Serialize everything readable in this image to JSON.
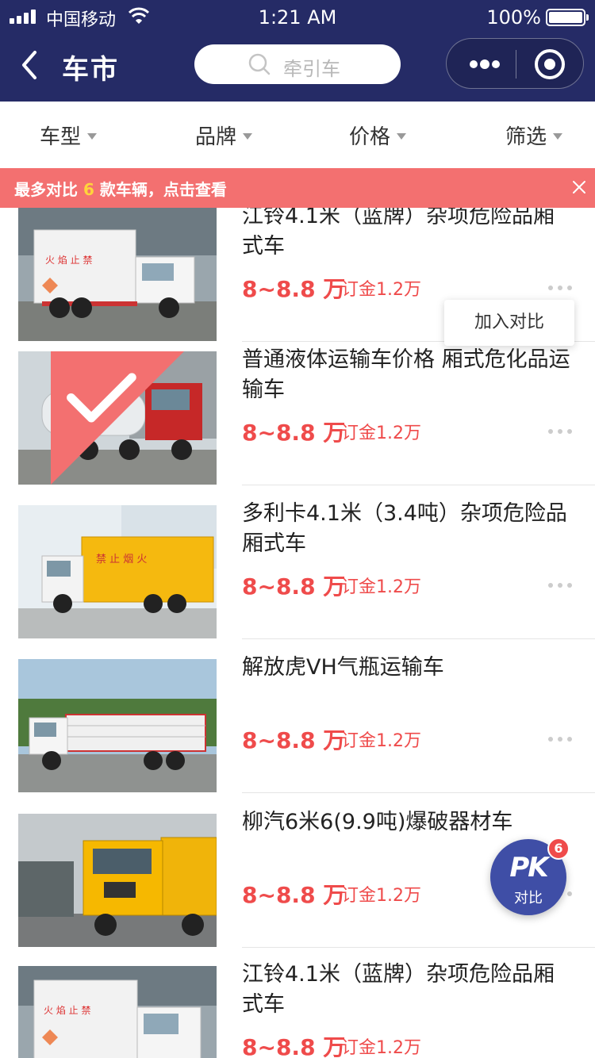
{
  "status_bar": {
    "carrier": "中国移动",
    "time": "1:21 AM",
    "battery": "100%"
  },
  "nav": {
    "title": "车市",
    "search_placeholder": "牵引车"
  },
  "filters": [
    {
      "label": "车型"
    },
    {
      "label": "品牌"
    },
    {
      "label": "价格"
    },
    {
      "label": "筛选"
    }
  ],
  "notice": {
    "prefix": "最多对比",
    "count": "6",
    "suffix": "款车辆，点击查看"
  },
  "compare_popup": {
    "label": "加入对比"
  },
  "pk_fab": {
    "text": "PK",
    "label": "对比",
    "badge": "6"
  },
  "colors": {
    "header": "#252b66",
    "notice": "#f37070",
    "price": "#ef4b4b",
    "fab": "#3f4ea6"
  },
  "items": [
    {
      "title": "江铃4.1米（蓝牌）杂项危险品厢式车",
      "price": "8~8.8 万",
      "deposit": "订金1.2万",
      "checked": false,
      "image": "white-box-truck"
    },
    {
      "title": "普通液体运输车价格 厢式危化品运输车",
      "price": "8~8.8 万",
      "deposit": "订金1.2万",
      "checked": true,
      "image": "red-tanker-truck"
    },
    {
      "title": "多利卡4.1米（3.4吨）杂项危险品厢式车",
      "price": "8~8.8 万",
      "deposit": "订金1.2万",
      "checked": false,
      "image": "yellow-box-truck"
    },
    {
      "title": "解放虎VH气瓶运输车",
      "price": "8~8.8 万",
      "deposit": "订金1.2万",
      "checked": false,
      "image": "gas-cylinder-truck"
    },
    {
      "title": "柳汽6米6(9.9吨)爆破器材车",
      "price": "8~8.8 万",
      "deposit": "订金1.2万",
      "checked": false,
      "image": "yellow-cargo-truck"
    },
    {
      "title": "江铃4.1米（蓝牌）杂项危险品厢式车",
      "price": "8~8.8 万",
      "deposit": "订金1.2万",
      "checked": false,
      "image": "white-box-truck"
    }
  ]
}
